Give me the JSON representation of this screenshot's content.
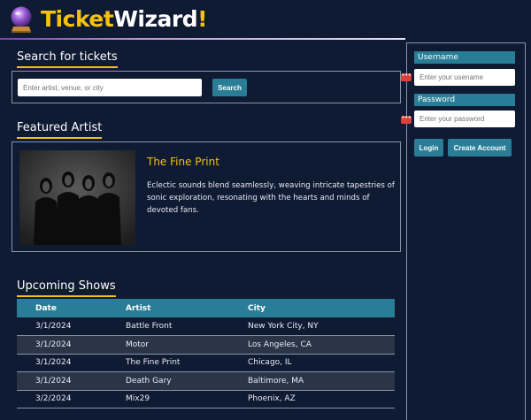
{
  "brand": {
    "part1": "Ticket",
    "part2": "Wizard",
    "part3": "!",
    "logo_icon": "crystal-ball-icon"
  },
  "search": {
    "title": "Search for tickets",
    "placeholder": "Enter artist, venue, or city",
    "button_label": "Search"
  },
  "featured": {
    "title": "Featured Artist",
    "artist_name": "The Fine Print",
    "description": "Eclectic sounds blend seamlessly, weaving intricate tapestries of sonic exploration, resonating with the hearts and minds of devoted fans."
  },
  "shows": {
    "title": "Upcoming Shows",
    "columns": [
      "Date",
      "Artist",
      "City"
    ],
    "rows": [
      [
        "3/1/2024",
        "Battle Front",
        "New York City, NY"
      ],
      [
        "3/1/2024",
        "Motor",
        "Los Angeles, CA"
      ],
      [
        "3/1/2024",
        "The Fine Print",
        "Chicago, IL"
      ],
      [
        "3/1/2024",
        "Death Gary",
        "Baltimore, MA"
      ],
      [
        "3/2/2024",
        "Mix29",
        "Phoenix, AZ"
      ]
    ]
  },
  "login": {
    "username_label": "Username",
    "username_placeholder": "Enter your usename",
    "password_label": "Password",
    "password_placeholder": "Enter your password",
    "login_button": "Login",
    "create_button": "Create Account"
  },
  "colors": {
    "background": "#0f1a33",
    "accent_yellow": "#f4c20d",
    "accent_teal": "#2a7d96",
    "badge_red": "#d9413a"
  }
}
